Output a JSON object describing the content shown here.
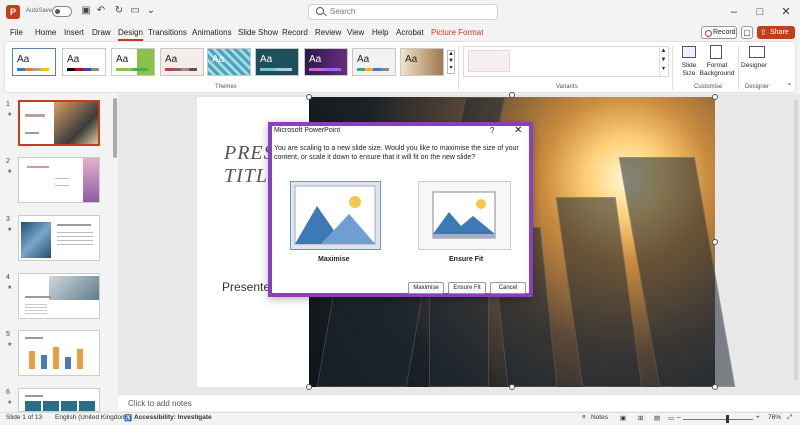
{
  "titlebar": {
    "app_icon": "P",
    "autosave_label": "AutoSave",
    "autosave_state": "Off",
    "search_placeholder": "Search",
    "icons": [
      "save-icon",
      "undo-icon",
      "redo-icon",
      "refresh-icon",
      "present-icon",
      "customise-icon",
      "minimise-icon",
      "restore-icon",
      "close-icon"
    ]
  },
  "menu": {
    "tabs": [
      "File",
      "Home",
      "Insert",
      "Draw",
      "Design",
      "Transitions",
      "Animations",
      "Slide Show",
      "Record",
      "Review",
      "View",
      "Help",
      "Acrobat",
      "Picture Format"
    ],
    "active": "Design",
    "record": "Record",
    "share": "Share"
  },
  "ribbon": {
    "themes_label": "Themes",
    "variants_label": "Variants",
    "customise_label": "Customise",
    "designer_group_label": "Designer",
    "slide_size": "Slide Size",
    "format_background": "Format Background",
    "designer": "Designer",
    "theme_sample": "Aa"
  },
  "thumbnails": [
    {
      "num": "1",
      "star": "★"
    },
    {
      "num": "2",
      "star": "★"
    },
    {
      "num": "3",
      "star": "★"
    },
    {
      "num": "4",
      "star": "★"
    },
    {
      "num": "5",
      "star": "★"
    },
    {
      "num": "6",
      "star": "★"
    }
  ],
  "slide": {
    "title_line1": "PRES",
    "title_line2": "TITL",
    "presenter": "Presenter"
  },
  "notes": {
    "placeholder": "Click to add notes"
  },
  "dialog": {
    "title": "Microsoft PowerPoint",
    "help": "?",
    "close": "✕",
    "message": "You are scaling to a new slide size.  Would you like to maximise the size of your content, or scale it down to ensure that it will fit on the new slide?",
    "option_maximise": "Maximise",
    "option_ensure": "Ensure Fit",
    "btn_maximise": "Maximise",
    "btn_ensure": "Ensure Fit",
    "btn_cancel": "Cancel"
  },
  "status": {
    "slide": "Slide 1 of 13",
    "language": "English (United Kingdom)",
    "accessibility": "Accessibility: Investigate",
    "notes": "Notes",
    "zoom": "76%",
    "zoom_minus": "–",
    "zoom_plus": "+"
  },
  "colors": {
    "accent": "#c43e1c",
    "dialog_border": "#8b3fc0"
  }
}
